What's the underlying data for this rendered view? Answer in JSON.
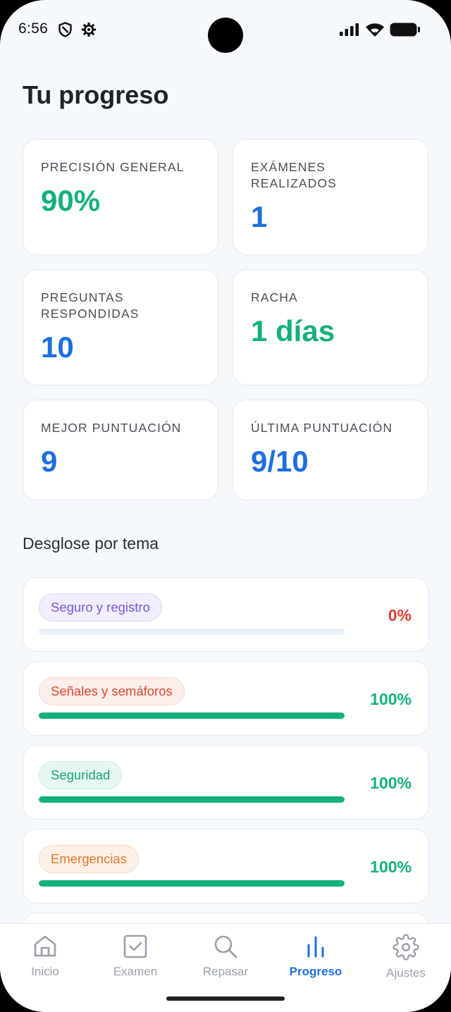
{
  "status_bar": {
    "time": "6:56"
  },
  "page_title": "Tu progreso",
  "stats": [
    {
      "label": "PRECISIÓN GENERAL",
      "value": "90%",
      "color": "#14b07c"
    },
    {
      "label": "EXÁMENES REALIZADOS",
      "value": "1",
      "color": "#1e6fe0"
    },
    {
      "label": "PREGUNTAS RESPONDIDAS",
      "value": "10",
      "color": "#1e6fe0"
    },
    {
      "label": "RACHA",
      "value": "1 días",
      "color": "#14b07c"
    },
    {
      "label": "MEJOR PUNTUACIÓN",
      "value": "9",
      "color": "#1e6fe0"
    },
    {
      "label": "ÚLTIMA PUNTUACIÓN",
      "value": "9/10",
      "color": "#1e6fe0"
    }
  ],
  "breakdown": {
    "title": "Desglose por tema",
    "topics": [
      {
        "name": "Seguro y registro",
        "percent_label": "0%",
        "progress": 0,
        "chip_color": "#7856d8"
      },
      {
        "name": "Señales y semáforos",
        "percent_label": "100%",
        "progress": 100,
        "chip_color": "#d9482f"
      },
      {
        "name": "Seguridad",
        "percent_label": "100%",
        "progress": 100,
        "chip_color": "#17a672"
      },
      {
        "name": "Emergencias",
        "percent_label": "100%",
        "progress": 100,
        "chip_color": "#e47930"
      }
    ]
  },
  "nav": {
    "items": [
      {
        "label": "Inicio",
        "icon": "home-icon"
      },
      {
        "label": "Examen",
        "icon": "checkbox-icon"
      },
      {
        "label": "Repasar",
        "icon": "search-icon"
      },
      {
        "label": "Progreso",
        "icon": "bar-chart-icon",
        "active": true
      },
      {
        "label": "Ajustes",
        "icon": "gear-icon"
      }
    ]
  },
  "colors": {
    "accent_blue": "#1e6fe0",
    "accent_green": "#14b07c",
    "accent_red": "#e0412f",
    "background": "#f5f8fd"
  }
}
